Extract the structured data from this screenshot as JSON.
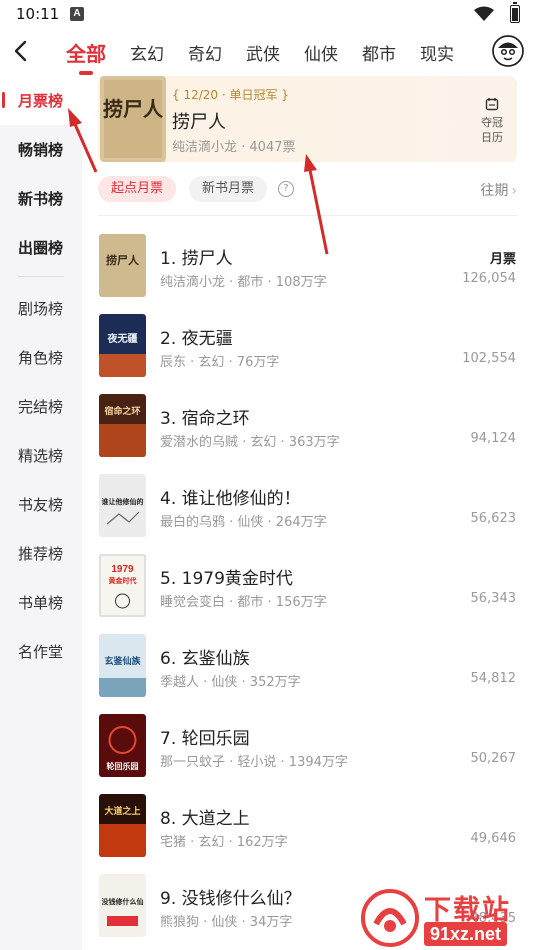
{
  "status_bar": {
    "time": "10:11",
    "notif_letter": "A"
  },
  "colors": {
    "accent": "#e2303b",
    "gold": "#b8862f",
    "watermark": "#e84040"
  },
  "top_tabs": [
    "全部",
    "玄幻",
    "奇幻",
    "武侠",
    "仙侠",
    "都市",
    "现实"
  ],
  "sidebar": {
    "items": [
      "月票榜",
      "畅销榜",
      "新书榜",
      "出圈榜",
      "剧场榜",
      "角色榜",
      "完结榜",
      "精选榜",
      "书友榜",
      "推荐榜",
      "书单榜",
      "名作堂"
    ]
  },
  "banner": {
    "badge": "{ 12/20 · 单日冠军 }",
    "title": "捞尸人",
    "meta": "纯洁滴小龙 · 4047票",
    "cal_label_1": "夺冠",
    "cal_label_2": "日历"
  },
  "filters": {
    "chip_active": "起点月票",
    "chip_normal": "新书月票",
    "help": "?",
    "past": "往期"
  },
  "list": {
    "votes_header": "月票",
    "rows": [
      {
        "title": "1. 捞尸人",
        "meta": "纯洁滴小龙 · 都市 · 108万字",
        "votes": "126,054"
      },
      {
        "title": "2. 夜无疆",
        "meta": "辰东 · 玄幻 · 76万字",
        "votes": "102,554"
      },
      {
        "title": "3. 宿命之环",
        "meta": "爱潜水的乌贼 · 玄幻 · 363万字",
        "votes": "94,124"
      },
      {
        "title": "4. 谁让他修仙的！",
        "meta": "最白的乌鸦 · 仙侠 · 264万字",
        "votes": "56,623"
      },
      {
        "title": "5. 1979黄金时代",
        "meta": "睡觉会变白 · 都市 · 156万字",
        "votes": "56,343"
      },
      {
        "title": "6. 玄鉴仙族",
        "meta": "季越人 · 仙侠 · 352万字",
        "votes": "54,812"
      },
      {
        "title": "7. 轮回乐园",
        "meta": "那一只蚊子 · 轻小说 · 1394万字",
        "votes": "50,267"
      },
      {
        "title": "8. 大道之上",
        "meta": "宅猪 · 玄幻 · 162万字",
        "votes": "49,646"
      },
      {
        "title": "9. 没钱修什么仙？",
        "meta": "熊狼狗 · 仙侠 · 34万字",
        "votes": "48,435"
      }
    ]
  },
  "covers": {
    "c1": "捞尸人",
    "c2": "夜无疆",
    "c3": "宿命之环",
    "c4": "谁让他修仙的",
    "c5": "1979",
    "c5b": "黄金时代",
    "c6": "玄鉴仙族",
    "c7": "轮回乐园",
    "c8": "大道之上",
    "c9": "没钱修什么仙"
  },
  "watermark": {
    "text": "下载站",
    "domain": "91xz.net"
  }
}
